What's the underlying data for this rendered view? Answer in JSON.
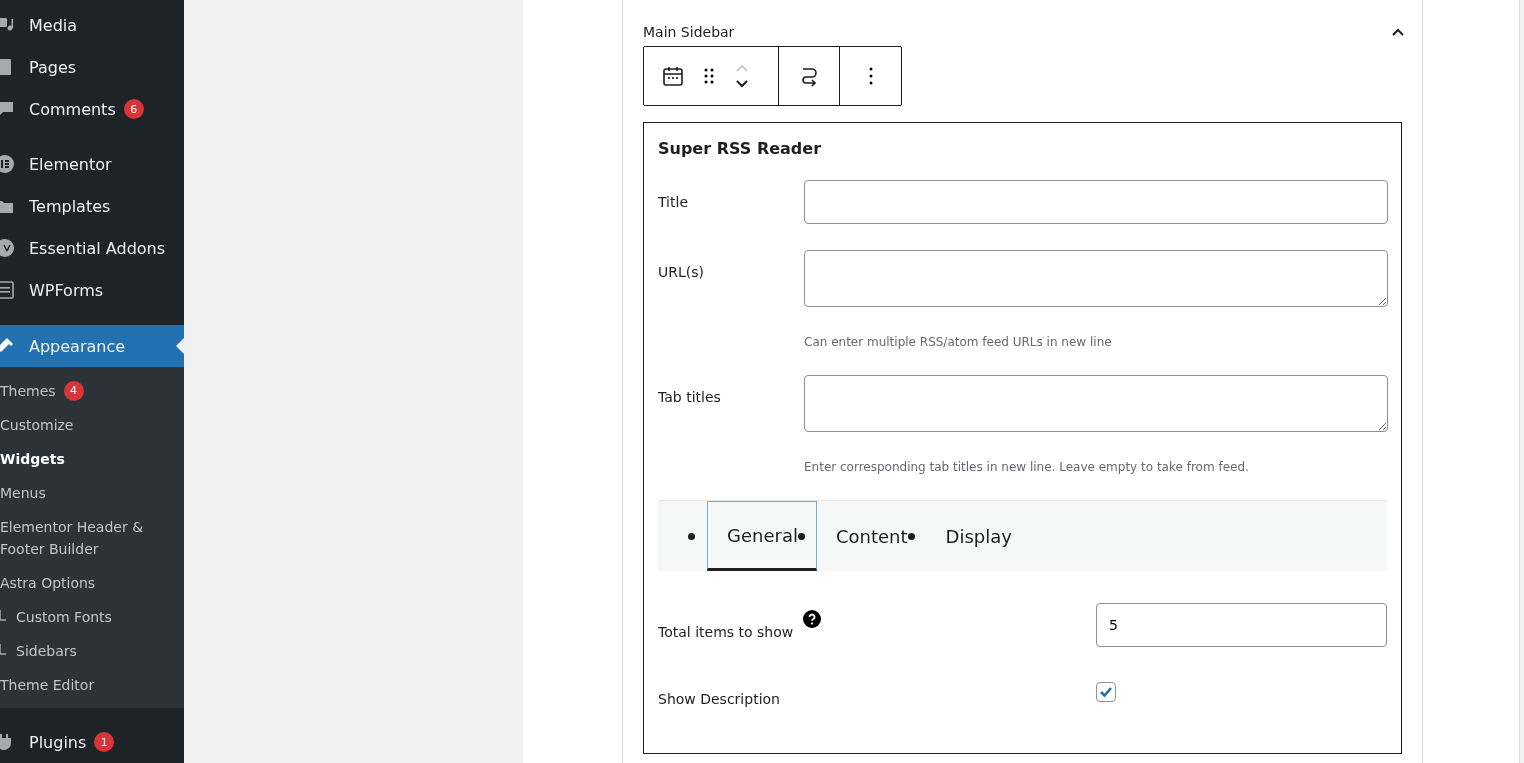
{
  "sidebar": {
    "items": [
      {
        "label": "Media",
        "selected": false
      },
      {
        "label": "Pages",
        "selected": false
      },
      {
        "label": "Comments",
        "badge": "6",
        "selected": false
      },
      {
        "label": "Elementor",
        "selected": false
      },
      {
        "label": "Templates",
        "selected": false
      },
      {
        "label": "Essential Addons",
        "selected": false
      },
      {
        "label": "WPForms",
        "selected": false
      },
      {
        "label": "Appearance",
        "selected": true,
        "children": [
          {
            "label": "Themes",
            "badge": "4",
            "selected": false
          },
          {
            "label": "Customize",
            "selected": false
          },
          {
            "label": "Widgets",
            "selected": true
          },
          {
            "label": "Menus",
            "selected": false
          },
          {
            "label": "Elementor Header & Footer Builder",
            "selected": false
          },
          {
            "label": "Astra Options",
            "selected": false,
            "children": [
              {
                "label": "Custom Fonts",
                "selected": false
              },
              {
                "label": "Sidebars",
                "selected": false
              }
            ]
          },
          {
            "label": "Theme Editor",
            "selected": false
          }
        ]
      },
      {
        "label": "Plugins",
        "badge": "1",
        "selected": false
      }
    ]
  },
  "area": {
    "title": "Main Sidebar",
    "expanded": true,
    "widget": {
      "title": "Super RSS Reader",
      "fields": [
        {
          "label": "Title",
          "kind": "input"
        },
        {
          "label": "URL(s)",
          "kind": "textarea",
          "help": "Can enter multiple RSS/atom feed URLs in new line"
        },
        {
          "label": "Tab titles",
          "kind": "textarea",
          "help": "Enter corresponding tab titles in new line. Leave empty to take from feed."
        }
      ],
      "tabs": [
        {
          "label": "General",
          "selected": true
        },
        {
          "label": "Content",
          "selected": false
        },
        {
          "label": "Display",
          "selected": false
        }
      ],
      "options": [
        {
          "label": "Total items to show",
          "kind": "number",
          "value": "5",
          "help_icon": true
        },
        {
          "label": "Show Description",
          "kind": "checkbox",
          "checked": true
        }
      ]
    }
  }
}
